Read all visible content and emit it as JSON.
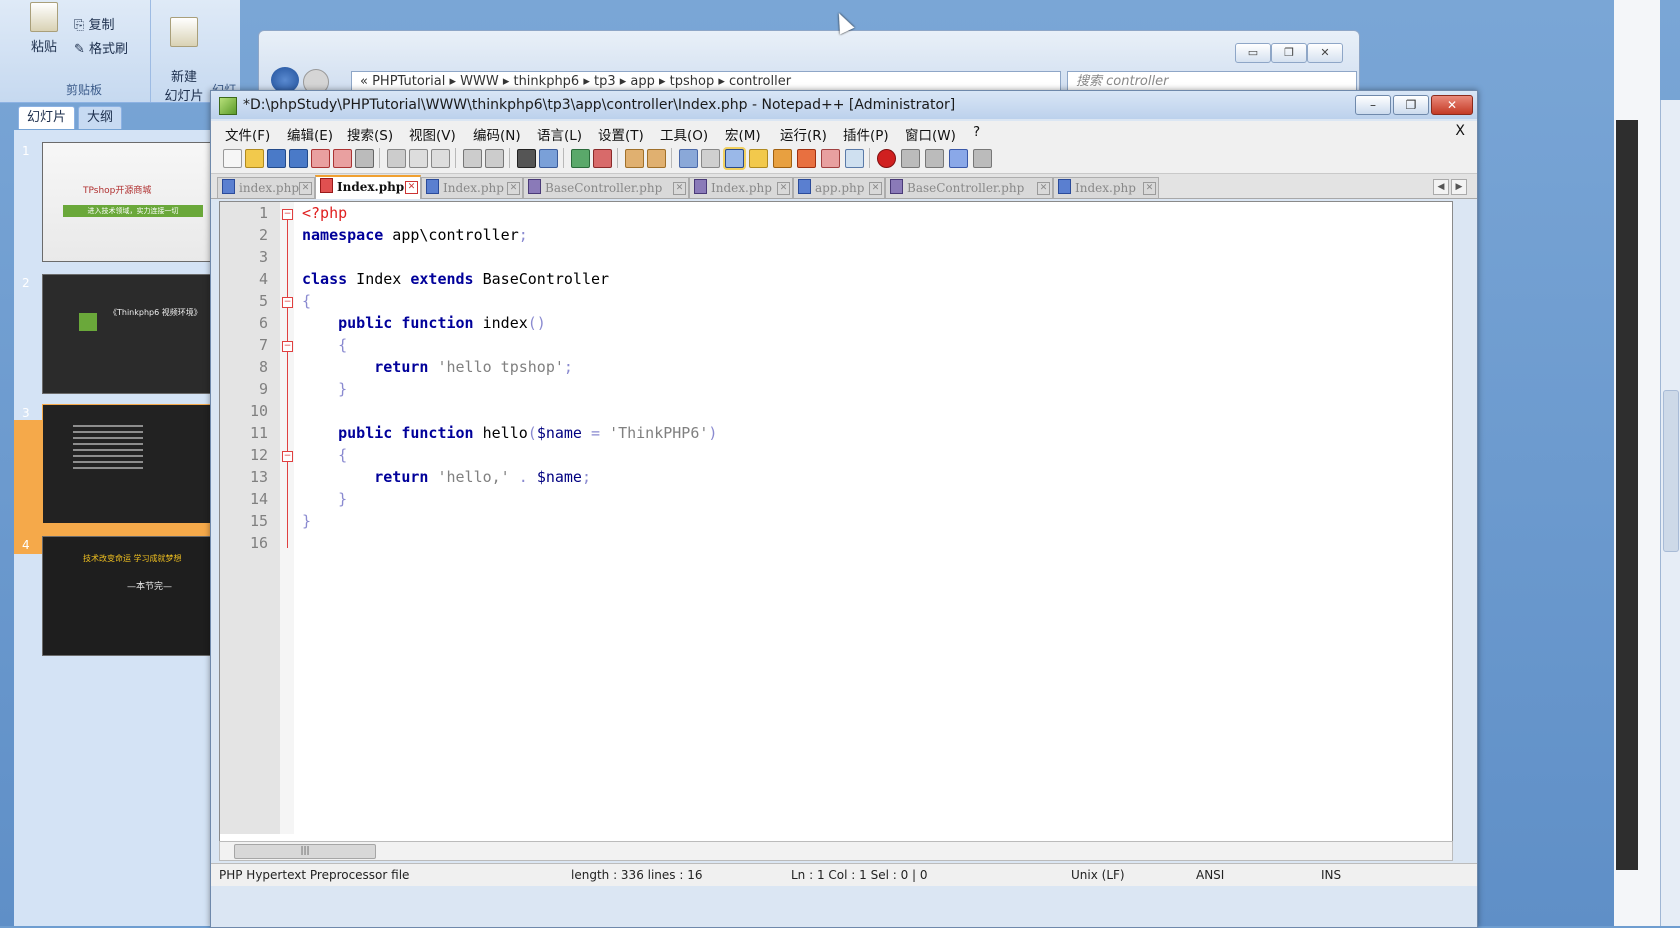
{
  "ppt": {
    "clipboard_group": "剪贴板",
    "paste": "粘贴",
    "copy": "复制",
    "format_painter": "格式刷",
    "new_slide": "新建\n幻灯片",
    "slides_group": "幻灯",
    "tab_slides": "幻灯片",
    "tab_outline": "大纲",
    "slides": [
      {
        "num": "1",
        "caption": "TPshop开源商城",
        "sub": "进入技术领域，实力连接一切"
      },
      {
        "num": "2",
        "caption": "《Thinkphp6 视频环境》"
      },
      {
        "num": "3",
        "caption": ""
      },
      {
        "num": "4",
        "caption": "技术改变命运  学习成就梦想",
        "sub": "—本节完—"
      }
    ]
  },
  "explorer": {
    "breadcrumb": "«  PHPTutorial  ▸  WWW  ▸  thinkphp6  ▸  tp3  ▸  app  ▸  tpshop  ▸  controller",
    "search_placeholder": "搜索 controller"
  },
  "npp": {
    "title": "*D:\\phpStudy\\PHPTutorial\\WWW\\thinkphp6\\tp3\\app\\controller\\Index.php - Notepad++ [Administrator]",
    "menu": [
      "文件(F)",
      "编辑(E)",
      "搜索(S)",
      "视图(V)",
      "编码(N)",
      "语言(L)",
      "设置(T)",
      "工具(O)",
      "宏(M)",
      "运行(R)",
      "插件(P)",
      "窗口(W)",
      "?"
    ],
    "menu_close": "X",
    "tabs": [
      "index.php",
      "Index.php",
      "Index.php",
      "BaseController.php",
      "Index.php",
      "app.php",
      "BaseController.php",
      "Index.php"
    ],
    "active_tab_index": 1,
    "lines": [
      "1",
      "2",
      "3",
      "4",
      "5",
      "6",
      "7",
      "8",
      "9",
      "10",
      "11",
      "12",
      "13",
      "14",
      "15",
      "16"
    ],
    "statusbar": {
      "lang": "PHP Hypertext Preprocessor file",
      "length": "length : 336    lines : 16",
      "pos": "Ln : 1    Col : 1    Sel : 0 | 0",
      "eol": "Unix (LF)",
      "encoding": "ANSI",
      "mode": "INS"
    }
  }
}
